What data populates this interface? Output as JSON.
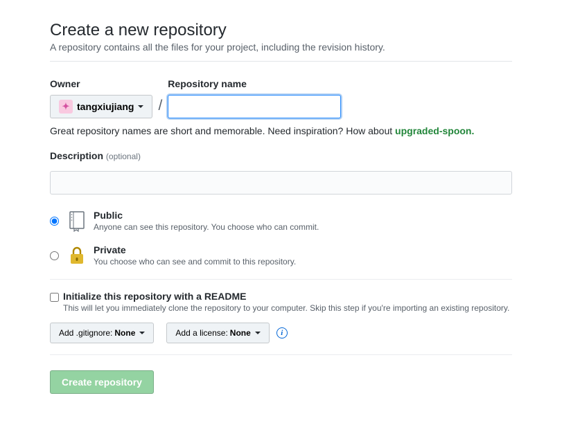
{
  "heading": "Create a new repository",
  "subtitle": "A repository contains all the files for your project, including the revision history.",
  "owner": {
    "label": "Owner",
    "username": "tangxiujiang"
  },
  "repoName": {
    "label": "Repository name",
    "value": ""
  },
  "hint": {
    "text": "Great repository names are short and memorable. Need inspiration? How about ",
    "suggestion": "upgraded-spoon.",
    "trail": ""
  },
  "description": {
    "label": "Description",
    "optional": "(optional)",
    "value": ""
  },
  "visibility": {
    "public": {
      "title": "Public",
      "desc": "Anyone can see this repository. You choose who can commit."
    },
    "private": {
      "title": "Private",
      "desc": "You choose who can see and commit to this repository."
    },
    "selected": "public"
  },
  "readme": {
    "title": "Initialize this repository with a README",
    "desc": "This will let you immediately clone the repository to your computer. Skip this step if you're importing an existing repository.",
    "checked": false
  },
  "gitignore": {
    "label": "Add .gitignore:",
    "value": "None"
  },
  "license": {
    "label": "Add a license:",
    "value": "None"
  },
  "submit": "Create repository"
}
